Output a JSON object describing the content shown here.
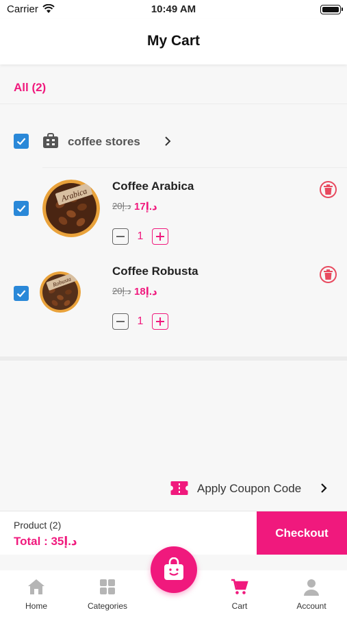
{
  "status_bar": {
    "carrier": "Carrier",
    "time": "10:49 AM"
  },
  "nav": {
    "title": "My Cart"
  },
  "filter": {
    "all_label": "All (2)"
  },
  "store": {
    "name": "coffee stores"
  },
  "items": [
    {
      "name": "Coffee Arabica",
      "old_price": "20د.إ",
      "new_price": "17د.إ",
      "quantity": "1",
      "image_label": "Arabica"
    },
    {
      "name": "Coffee Robusta",
      "old_price": "20د.إ",
      "new_price": "18د.إ",
      "quantity": "1",
      "image_label": "Robusta"
    }
  ],
  "coupon": {
    "label": "Apply Coupon Code"
  },
  "summary": {
    "product_count": "Product (2)",
    "total": "Total : 35د.إ",
    "checkout_label": "Checkout"
  },
  "tabs": [
    {
      "label": "Home",
      "icon": "home-icon"
    },
    {
      "label": "Categories",
      "icon": "categories-icon"
    },
    {
      "label": "Cart",
      "icon": "cart-icon"
    },
    {
      "label": "Account",
      "icon": "account-icon"
    }
  ],
  "colors": {
    "accent": "#f0197d",
    "checkbox": "#2a88d8",
    "trash": "#e84a5f",
    "inactive_tab": "#b5b5b5"
  }
}
